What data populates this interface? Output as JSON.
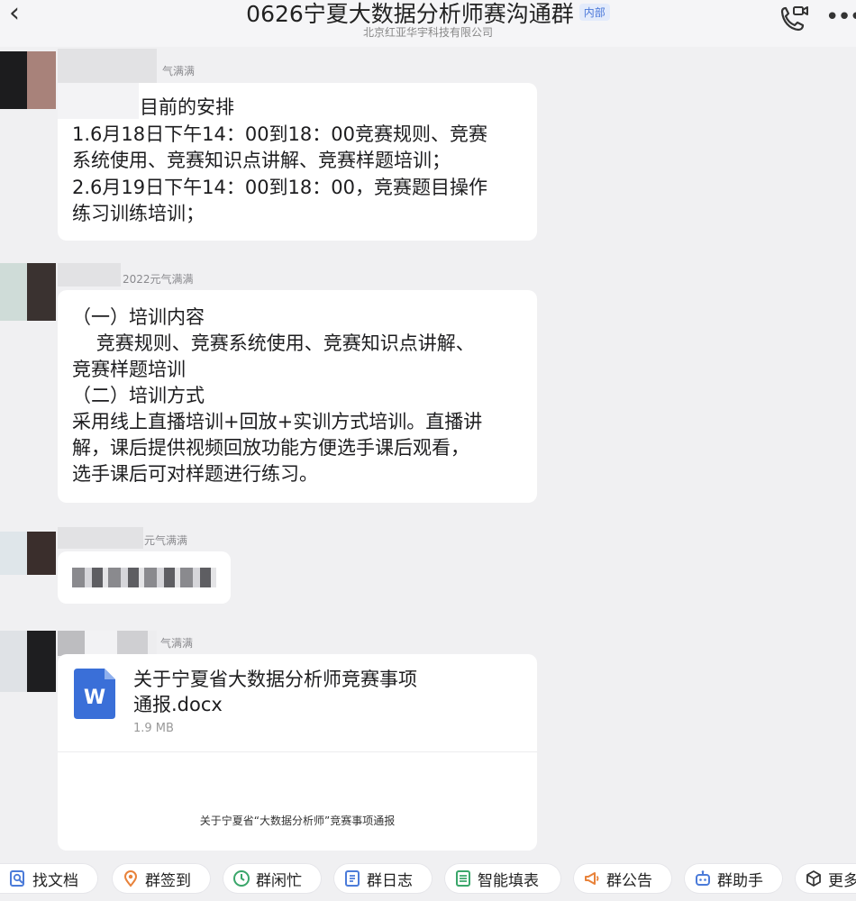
{
  "header": {
    "back_glyph": "‹",
    "title": "0626宁夏大数据分析师赛沟通群",
    "badge": "内部",
    "subtitle": "北京红亚华宇科技有限公司",
    "icons": [
      "back-icon",
      "video-call-icon",
      "more-icon"
    ]
  },
  "messages": [
    {
      "sender": "气满满",
      "lines": [
        "目前的安排",
        "1.6月18日下午14：00到18：00竞赛规则、竞赛",
        "系统使用、竞赛知识点讲解、竞赛样题培训；",
        "2.6月19日下午14：00到18：00，竞赛题目操作",
        "练习训练培训；"
      ]
    },
    {
      "sender": "2022元气满满",
      "lines": [
        "（一）培训内容",
        "    竞赛规则、竞赛系统使用、竞赛知识点讲解、",
        "竞赛样题培训",
        "（二）培训方式",
        "采用线上直播培训+回放+实训方式培训。直播讲",
        "解，课后提供视频回放功能方便选手课后观看，",
        "选手课后可对样题进行练习。"
      ]
    },
    {
      "sender": "元气满满",
      "lines": []
    },
    {
      "sender": "气满满",
      "file": {
        "icon_letter": "W",
        "name_lines": [
          "关于宁夏省大数据分析师竞赛事项",
          "通报.docx"
        ],
        "size": "1.9 MB",
        "preview": "关于宁夏省“大数据分析师”竞赛事项通报"
      }
    }
  ],
  "toolbar": [
    {
      "label": "找文档",
      "icon": "search-doc-icon"
    },
    {
      "label": "群签到",
      "icon": "checkin-pin-icon"
    },
    {
      "label": "群闲忙",
      "icon": "clock-icon"
    },
    {
      "label": "群日志",
      "icon": "log-icon"
    },
    {
      "label": "智能填表",
      "icon": "form-icon"
    },
    {
      "label": "群公告",
      "icon": "announcement-icon"
    },
    {
      "label": "群助手",
      "icon": "robot-icon"
    },
    {
      "label": "更多",
      "icon": "more-box-icon"
    }
  ],
  "colors": {
    "background": "#f0f0f2",
    "bubble": "#ffffff",
    "badge": "#4b78d9",
    "word_blue": "#3a6fd8",
    "toolbar_icon": "#4b7bd9",
    "toolbar_icon_orange": "#e8823a",
    "toolbar_icon_green": "#3aa66a"
  }
}
